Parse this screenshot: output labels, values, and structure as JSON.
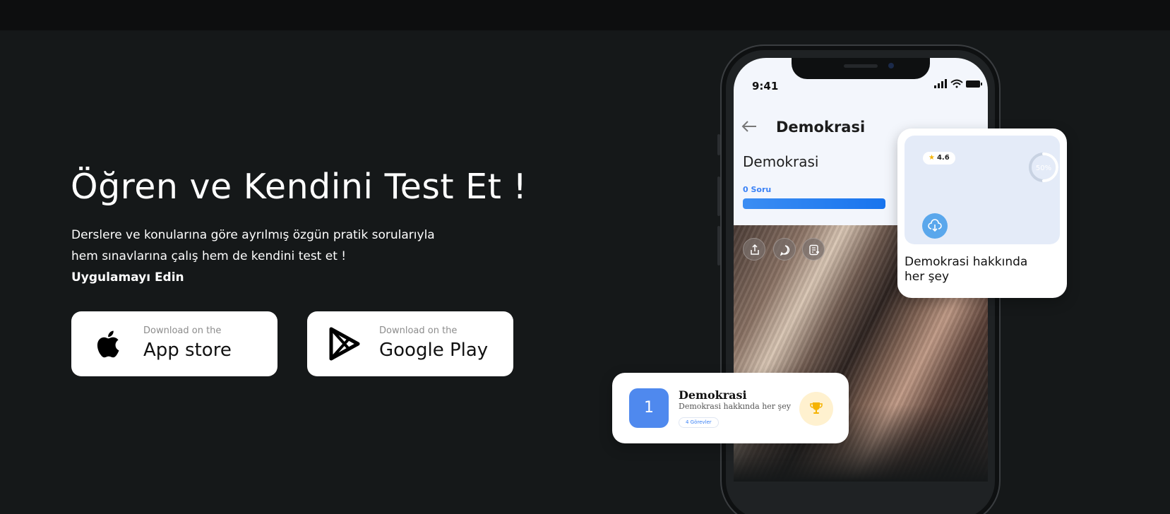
{
  "hero": {
    "title": "Öğren ve Kendini Test Et !",
    "line1": "Derslere ve konularına göre ayrılmış özgün pratik sorularıyla",
    "line2": "hem sınavlarına çalış hem de kendini test et !",
    "cta": "Uygulamayı Edin"
  },
  "stores": {
    "apple": {
      "small": "Download on the",
      "big": "App store",
      "icon": "apple-icon"
    },
    "google": {
      "small": "Download on the",
      "big": "Google Play",
      "icon": "google-play-icon"
    }
  },
  "phone": {
    "time": "9:41",
    "nav_title": "Demokrasi",
    "section_title": "Demokrasi",
    "question_count": "0 Soru",
    "progress": 1.0
  },
  "info_card": {
    "rating": "4.6",
    "ring_label": "50%",
    "ring_value": 0.5,
    "caption_line1": "Demokrasi hakkında",
    "caption_line2": "her şey"
  },
  "course_card": {
    "number": "1",
    "title": "Demokrasi",
    "subtitle": "Demokrasi hakkında her şey",
    "chip": "4 Görevler"
  },
  "colors": {
    "background": "#151819",
    "accent_blue": "#3b82f6",
    "trophy_bg": "#fff1cf"
  }
}
